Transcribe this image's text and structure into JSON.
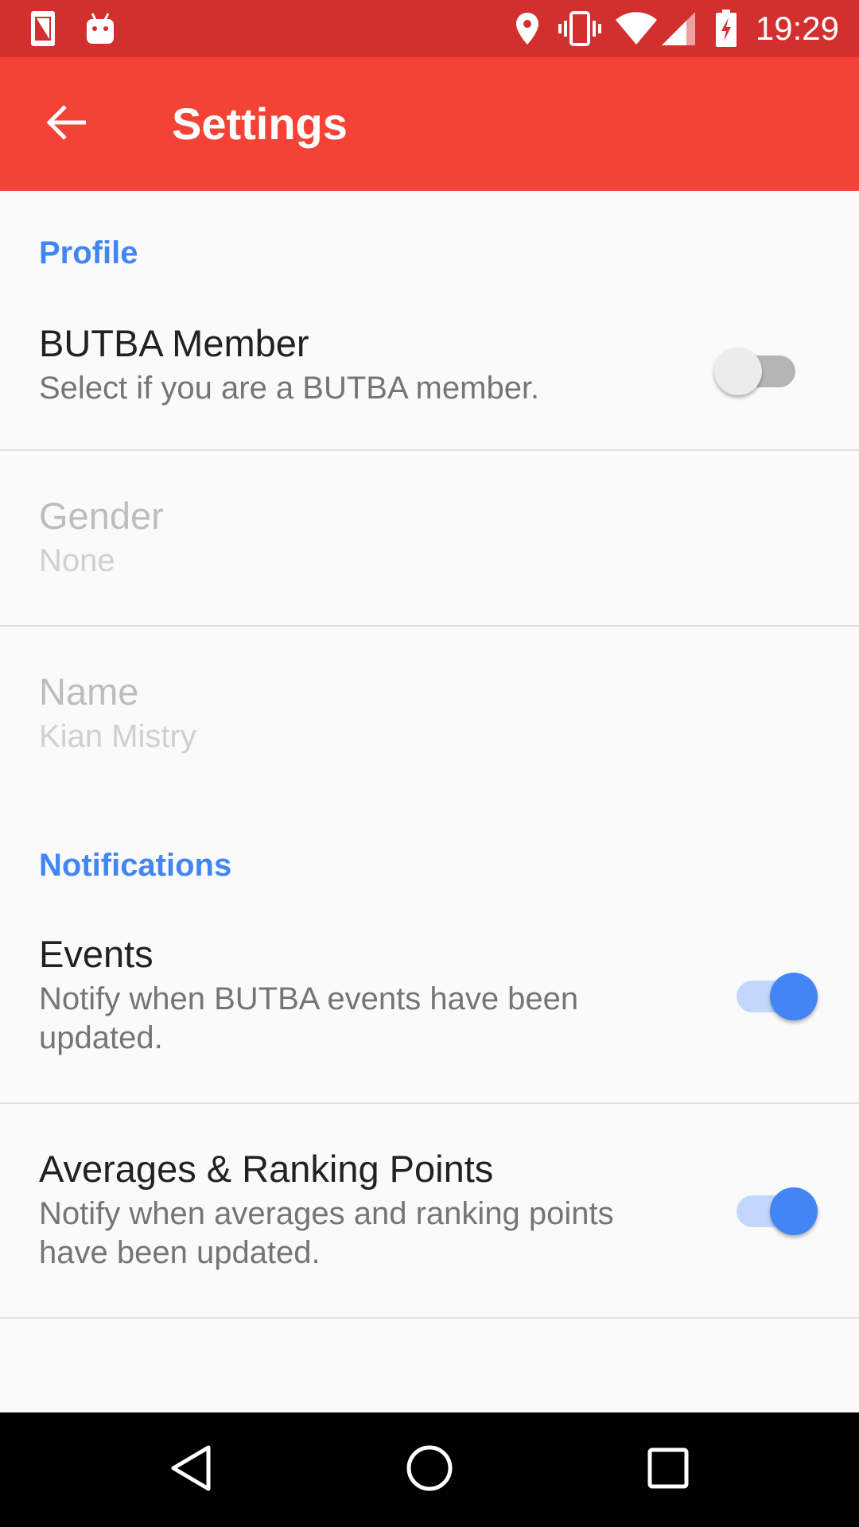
{
  "status_bar": {
    "time": "19:29",
    "left_icons": [
      "sim-card-icon",
      "android-debug-icon"
    ],
    "right_icons": [
      "location-pin-icon",
      "vibrate-icon",
      "wifi-icon",
      "cell-signal-icon",
      "battery-charging-icon"
    ]
  },
  "app_bar": {
    "title": "Settings",
    "back_icon": "arrow-back-icon",
    "color": "#f44336"
  },
  "sections": {
    "profile": {
      "header": "Profile",
      "butba_member": {
        "title": "BUTBA Member",
        "summary": "Select if you are a BUTBA member.",
        "enabled": false
      },
      "gender": {
        "title": "Gender",
        "summary": "None"
      },
      "name": {
        "title": "Name",
        "summary": "Kian Mistry"
      }
    },
    "notifications": {
      "header": "Notifications",
      "events": {
        "title": "Events",
        "summary": "Notify when BUTBA events have been updated.",
        "enabled": true
      },
      "averages": {
        "title": "Averages & Ranking Points",
        "summary": "Notify when averages and ranking points have been updated.",
        "enabled": true
      }
    }
  },
  "colors": {
    "status_bar": "#d32f2f",
    "accent": "#4285f4"
  },
  "nav_bar": {
    "icons": [
      "back-triangle-icon",
      "home-circle-icon",
      "recents-square-icon"
    ]
  }
}
